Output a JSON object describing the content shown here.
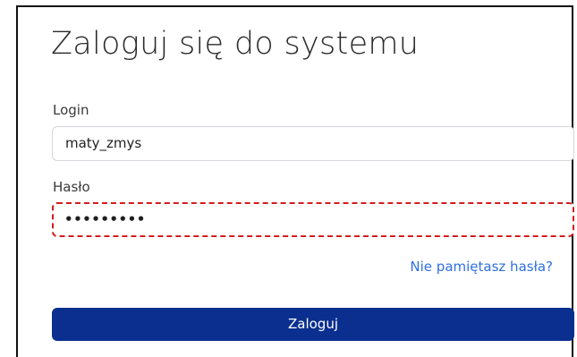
{
  "form": {
    "title": "Zaloguj się do systemu",
    "login": {
      "label": "Login",
      "value": "maty_zmys"
    },
    "password": {
      "label": "Hasło",
      "masked_value": "•••••••••"
    },
    "forgot_link": "Nie pamiętasz hasła?",
    "submit_label": "Zaloguj"
  },
  "colors": {
    "primary_button": "#0a2f8f",
    "link": "#2f6fe0",
    "highlight_dashed_border": "#d41d1d"
  }
}
